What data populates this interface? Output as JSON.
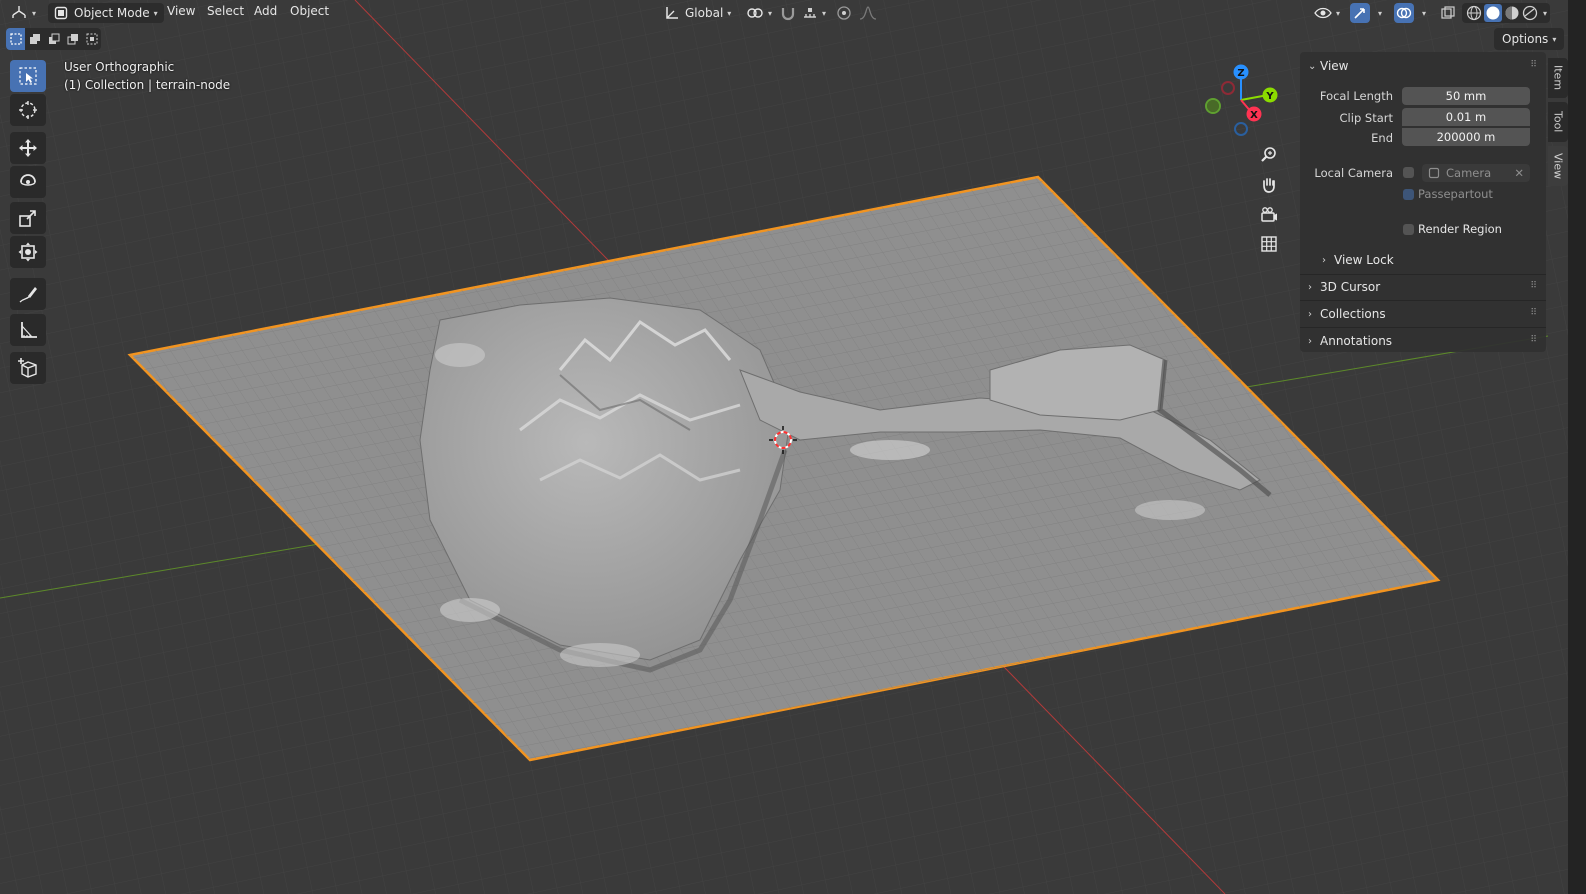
{
  "header": {
    "editor_type_icon": "view3d-icon",
    "mode": "Object Mode",
    "menus": [
      "View",
      "Select",
      "Add",
      "Object"
    ],
    "transform_orientation": "Global",
    "options_label": "Options"
  },
  "viewport": {
    "view_name": "User Orthographic",
    "collection_info": "(1) Collection | terrain-node"
  },
  "gizmo": {
    "axes": [
      "Z",
      "Y",
      "X"
    ],
    "colors": {
      "x": "#ff3352",
      "y": "#8bdc00",
      "z": "#2890ff",
      "selection": "#ff8c1a",
      "accent": "#4772b3"
    }
  },
  "toolbar": {
    "tools": [
      "select-box-icon",
      "cursor-icon",
      "move-icon",
      "rotate-icon",
      "scale-icon",
      "transform-icon",
      "annotate-icon",
      "measure-icon",
      "add-cube-icon"
    ]
  },
  "sidebar": {
    "tabs": [
      "Item",
      "Tool",
      "View"
    ],
    "view_panel": {
      "title": "View",
      "focal_length_label": "Focal Length",
      "focal_length_value": "50 mm",
      "clip_start_label": "Clip Start",
      "clip_start_value": "0.01 m",
      "end_label": "End",
      "end_value": "200000 m",
      "local_camera_label": "Local Camera",
      "camera_placeholder": "Camera",
      "passepartout_label": "Passepartout",
      "render_region_label": "Render Region",
      "view_lock_label": "View Lock"
    },
    "collapsed_panels": [
      "3D Cursor",
      "Collections",
      "Annotations"
    ]
  }
}
